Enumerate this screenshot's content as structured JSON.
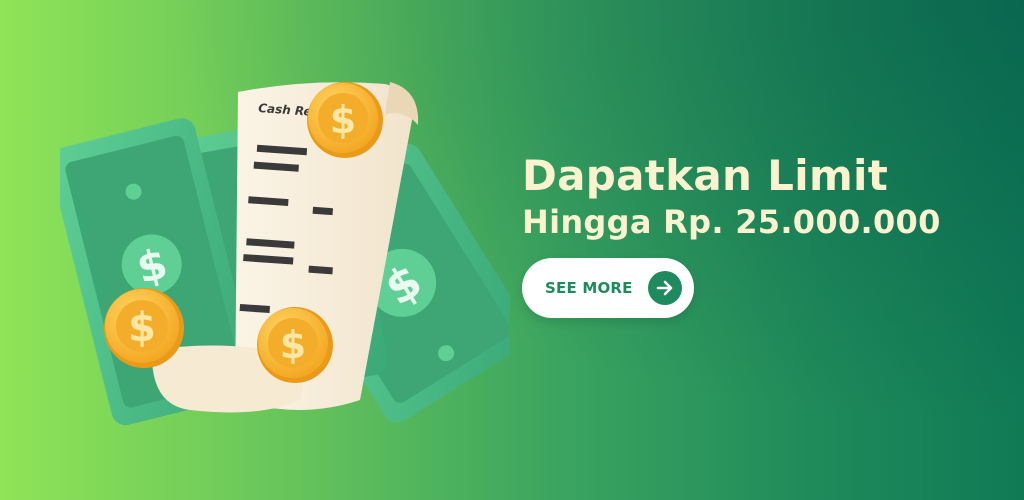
{
  "banner": {
    "headline_line1": "Dapatkan Limit",
    "headline_line2": "Hingga Rp. 25.000.000",
    "cta_label": "SEE MORE",
    "receipt_title": "Cash Re",
    "coin_symbol": "$"
  },
  "icons": {
    "cta_icon": "arrow-right-icon",
    "illustration": [
      "banknote-icon",
      "receipt-icon",
      "coin-icon"
    ]
  },
  "colors": {
    "background_start": "#8fe457",
    "background_end": "#107a56",
    "headline": "#fbf3cf",
    "cta_background": "#ffffff",
    "cta_accent": "#1e8a5e",
    "banknote": "#4fbf8a",
    "coin": "#f7b733"
  }
}
